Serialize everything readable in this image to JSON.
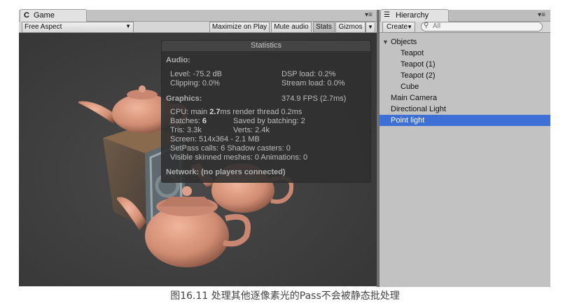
{
  "game": {
    "tab_icon": "unity-game-icon",
    "tab_glyph": "C",
    "tab_label": "Game",
    "menu_glyph": "▾≡",
    "aspect": "Free Aspect",
    "toolbar_buttons": [
      "Maximize on Play",
      "Mute audio",
      "Stats",
      "Gizmos"
    ],
    "active_button": "Stats"
  },
  "stats": {
    "title": "Statistics",
    "audio_header": "Audio:",
    "level": "Level: -75.2 dB",
    "dsp_load": "DSP load: 0.2%",
    "clipping": "Clipping: 0.0%",
    "stream_load": "Stream load: 0.0%",
    "graphics_header": "Graphics:",
    "fps": "374.9 FPS (2.7ms)",
    "cpu_prefix": "CPU: main ",
    "cpu_main": "2.7",
    "cpu_suffix": "ms  render thread 0.2ms",
    "batches_prefix": "Batches: ",
    "batches": "6",
    "saved_by_batching": "Saved by batching: 2",
    "tris": "Tris: 3.3k",
    "verts": "Verts: 2.4k",
    "screen": "Screen: 514x364 - 2.1 MB",
    "setpass": "SetPass calls: 6   Shadow casters: 0",
    "skinned": "Visible skinned meshes: 0  Animations: 0",
    "network": "Network: (no players connected)"
  },
  "hierarchy": {
    "tab_icon": "hierarchy-icon",
    "tab_glyph": "☰",
    "tab_label": "Hierarchy",
    "menu_glyph": "▾≡",
    "create_label": "Create",
    "search_placeholder": "All",
    "items": [
      {
        "label": "Objects",
        "expander": "▼"
      },
      {
        "label": "Teapot"
      },
      {
        "label": "Teapot (1)"
      },
      {
        "label": "Teapot (2)"
      },
      {
        "label": "Cube"
      },
      {
        "label": "Main Camera"
      },
      {
        "label": "Directional Light"
      },
      {
        "label": "Point light",
        "selected": true
      }
    ]
  },
  "caption": "图16.11 处理其他逐像素光的Pass不会被静态批处理",
  "colors": {
    "selection": "#3d6fd6",
    "viewport_bg": "#3d3d3d",
    "teapot": "#d9967c",
    "stats_bg": "#303030"
  }
}
